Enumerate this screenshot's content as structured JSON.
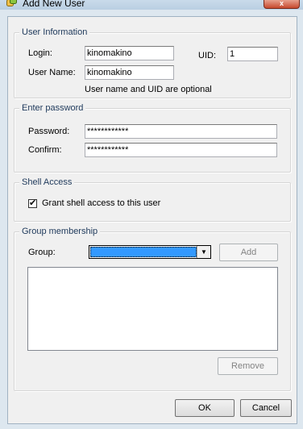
{
  "window": {
    "title": "Add New User",
    "close_glyph": "x"
  },
  "user_info": {
    "legend": "User Information",
    "login_label": "Login:",
    "login_value": "kinomakino",
    "uid_label": "UID:",
    "uid_value": "1",
    "username_label": "User Name:",
    "username_value": "kinomakino",
    "hint": "User name and UID are optional"
  },
  "password": {
    "legend": "Enter password",
    "password_label": "Password:",
    "password_value": "************",
    "confirm_label": "Confirm:",
    "confirm_value": "************"
  },
  "shell": {
    "legend": "Shell Access",
    "checkbox_label": "Grant shell access to this user",
    "checked": true,
    "check_glyph": "✔"
  },
  "groups": {
    "legend": "Group membership",
    "group_label": "Group:",
    "group_value": "",
    "add_label": "Add",
    "remove_label": "Remove",
    "list_items": []
  },
  "footer": {
    "ok_label": "OK",
    "cancel_label": "Cancel"
  },
  "colors": {
    "accent": "#3399ff",
    "legend_text": "#1e395b"
  }
}
